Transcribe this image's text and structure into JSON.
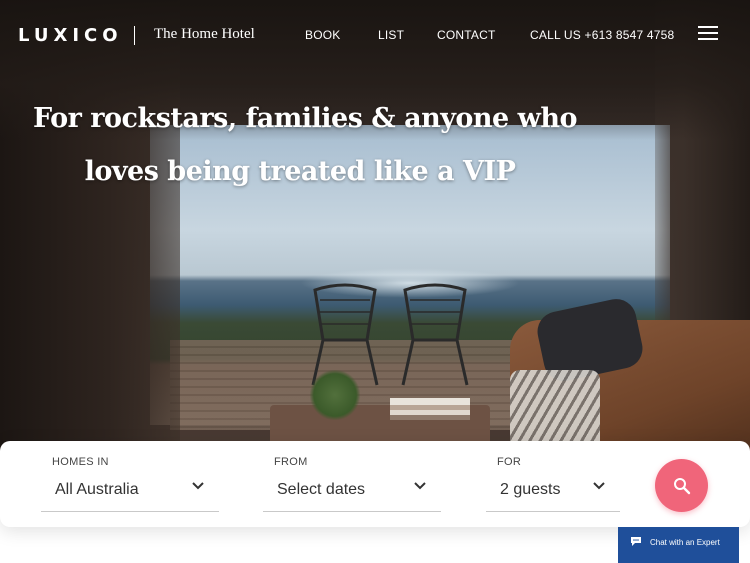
{
  "header": {
    "logo": "LUXICO",
    "tagline": "The Home Hotel",
    "nav": {
      "book": "BOOK",
      "list": "LIST",
      "contact": "CONTACT",
      "call": "CALL US +613 8547 4758"
    },
    "menu_icon": "hamburger-icon"
  },
  "hero": {
    "headline_line1": "For rockstars, families & anyone who",
    "headline_line2": "loves being treated like a VIP"
  },
  "search": {
    "homes_in": {
      "label": "HOMES IN",
      "value": "All Australia"
    },
    "from": {
      "label": "FROM",
      "value": "Select dates"
    },
    "for": {
      "label": "FOR",
      "value": "2 guests"
    },
    "button_icon": "search-icon",
    "accent_color": "#f0657a"
  },
  "chat": {
    "label": "Chat with an Expert",
    "icon": "chat-bubble-icon",
    "color": "#1f4f9a"
  }
}
